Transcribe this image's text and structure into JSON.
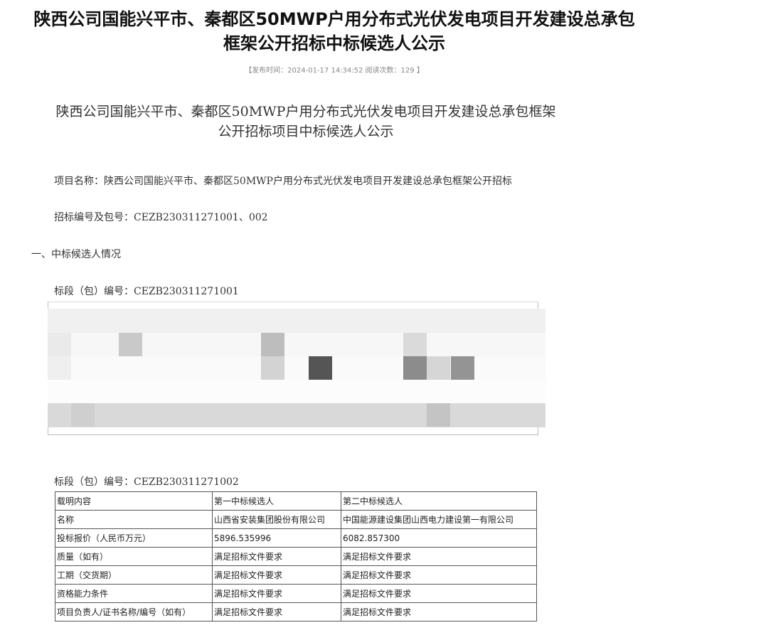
{
  "page": {
    "title_line1": "陕西公司国能兴平市、秦都区50MWP户用分布式光伏发电项目开发建设总承包",
    "title_line2": "框架公开招标中标候选人公示",
    "meta": "【发布时间：2024-01-17 14:34:52 阅读次数：129 】"
  },
  "document": {
    "title_line1": "陕西公司国能兴平市、秦都区50MWP户用分布式光伏发电项目开发建设总承包框架",
    "title_line2": "公开招标项目中标候选人公示",
    "project_name": "项目名称：陕西公司国能兴平市、秦都区50MWP户用分布式光伏发电项目开发建设总承包框架公开招标",
    "tender_code": "招标编号及包号：CEZB230311271001、002",
    "section_heading": "一、中标候选人情况",
    "lot1_heading": "标段（包）编号：CEZB230311271001",
    "lot2_heading": "标段（包）编号：CEZB230311271002"
  },
  "lot2_table": {
    "rows": [
      [
        "载明内容",
        "第一中标候选人",
        "第二中标候选人"
      ],
      [
        "名称",
        "山西省安装集团股份有限公司",
        "中国能源建设集团山西电力建设第一有限公司"
      ],
      [
        "投标报价（人民币万元）",
        "5896.535996",
        "6082.857300"
      ],
      [
        "质量（如有）",
        "满足招标文件要求",
        "满足招标文件要求"
      ],
      [
        "工期（交货期）",
        "满足招标文件要求",
        "满足招标文件要求"
      ],
      [
        "资格能力条件",
        "满足招标文件要求",
        "满足招标文件要求"
      ],
      [
        "项目负责人/证书名称/编号（如有）",
        "满足招标文件要求",
        "满足招标文件要求"
      ]
    ]
  }
}
